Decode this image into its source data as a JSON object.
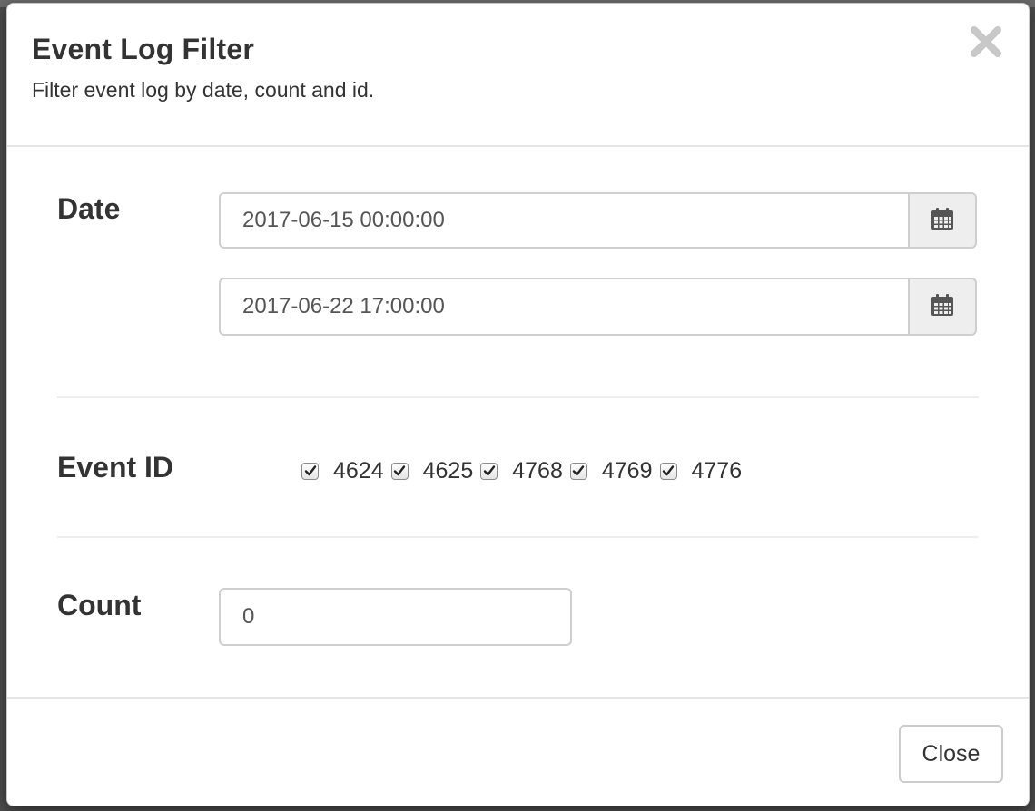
{
  "modal": {
    "title": "Event Log Filter",
    "subtitle": "Filter event log by date, count and id."
  },
  "date": {
    "label": "Date",
    "start_value": "2017-06-15 00:00:00",
    "end_value": "2017-06-22 17:00:00",
    "picker_icon": "calendar-icon"
  },
  "event_id": {
    "label": "Event ID",
    "options": [
      {
        "label": "4624",
        "checked": true
      },
      {
        "label": "4625",
        "checked": true
      },
      {
        "label": "4768",
        "checked": true
      },
      {
        "label": "4769",
        "checked": true
      },
      {
        "label": "4776",
        "checked": true
      }
    ]
  },
  "count": {
    "label": "Count",
    "value": "0"
  },
  "footer": {
    "close_label": "Close"
  },
  "colors": {
    "text": "#333333",
    "input_text": "#555555",
    "addon_bg": "#eeeeee",
    "border": "#cfcfcf",
    "close_icon": "#c8c8c8"
  }
}
